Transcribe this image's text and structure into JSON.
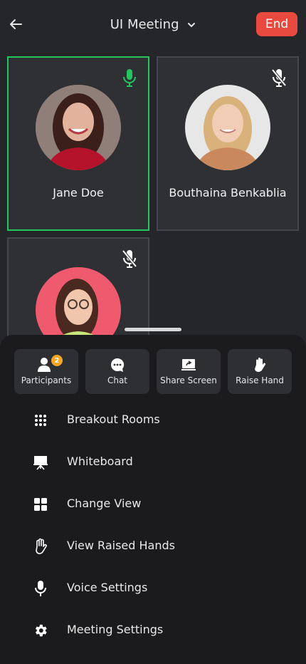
{
  "header": {
    "title": "UI Meeting",
    "end_label": "End"
  },
  "participants": [
    {
      "name": "Jane Doe",
      "mic": "mic-on",
      "active": true
    },
    {
      "name": "Bouthaina Benkablia",
      "mic": "mic-off",
      "active": false
    },
    {
      "name": "",
      "mic": "mic-off",
      "active": false
    }
  ],
  "quick_actions": [
    {
      "label": "Participants",
      "icon": "participants-icon",
      "badge": "2"
    },
    {
      "label": "Chat",
      "icon": "chat-icon"
    },
    {
      "label": "Share Screen",
      "icon": "share-screen-icon"
    },
    {
      "label": "Raise Hand",
      "icon": "raise-hand-icon"
    }
  ],
  "menu": [
    {
      "label": "Breakout Rooms",
      "icon": "grid-dots-icon"
    },
    {
      "label": "Whiteboard",
      "icon": "whiteboard-icon"
    },
    {
      "label": "Change View",
      "icon": "layout-grid-icon"
    },
    {
      "label": "View Raised Hands",
      "icon": "hand-icon"
    },
    {
      "label": "Voice Settings",
      "icon": "microphone-icon"
    },
    {
      "label": "Meeting Settings",
      "icon": "gear-icon"
    }
  ],
  "colors": {
    "accent_end": "#e84a3f",
    "active_speaker": "#22c55e",
    "badge": "#f5a623"
  }
}
